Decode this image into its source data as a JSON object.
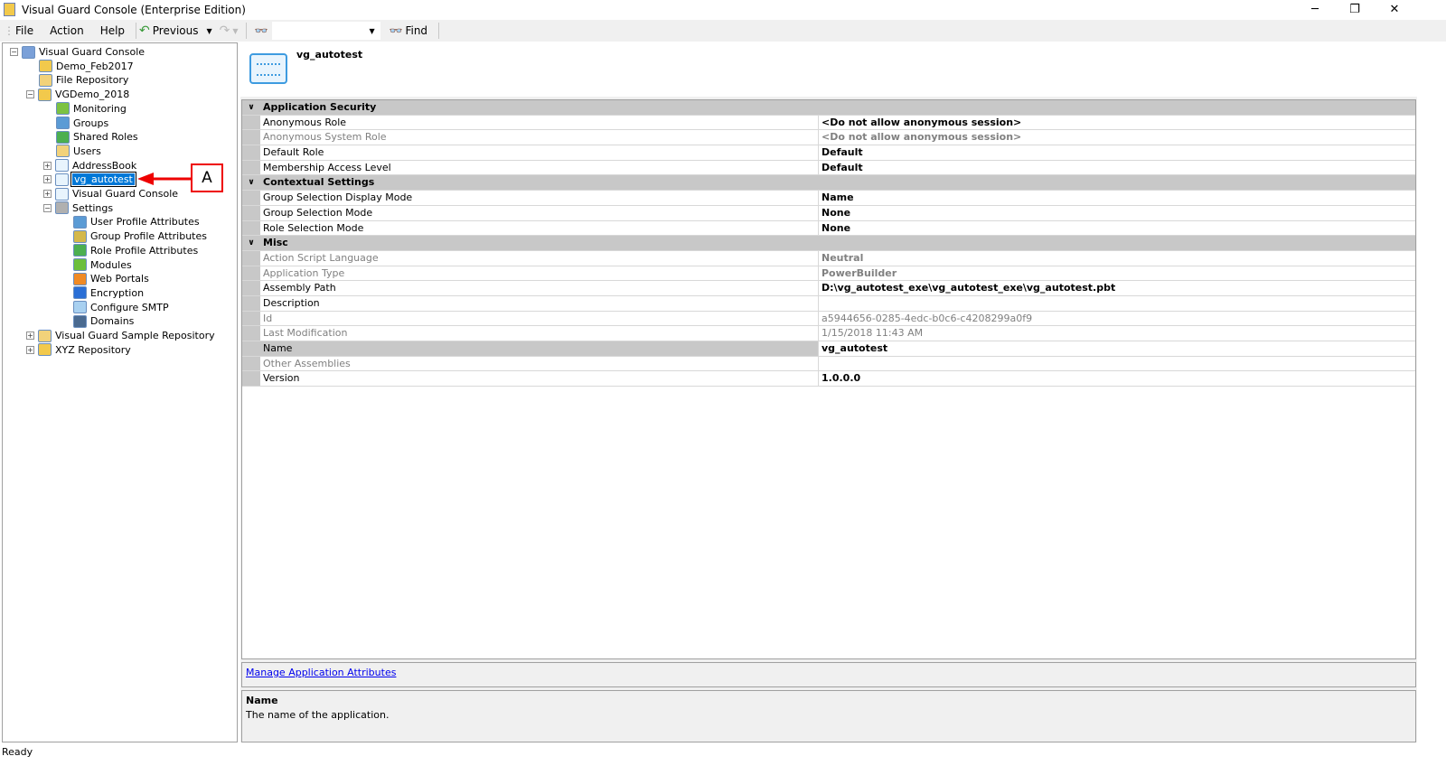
{
  "window": {
    "title": "Visual Guard Console (Enterprise Edition)",
    "minimize": "─",
    "restore": "❐",
    "close": "✕"
  },
  "menu": {
    "file": "File",
    "action": "Action",
    "help": "Help",
    "previous": "Previous",
    "find": "Find",
    "find_value": ""
  },
  "tree": [
    {
      "label": "Visual Guard Console",
      "level": 0,
      "exp": "-",
      "color": "#7aa0d8"
    },
    {
      "label": "Demo_Feb2017",
      "level": 1,
      "exp": "",
      "color": "#f2c94c"
    },
    {
      "label": "File Repository",
      "level": 1,
      "exp": "",
      "color": "#f2d27a"
    },
    {
      "label": "VGDemo_2018",
      "level": 1,
      "exp": "-",
      "color": "#f2c94c"
    },
    {
      "label": "Monitoring",
      "level": 2,
      "exp": "",
      "color": "#7cc242"
    },
    {
      "label": "Groups",
      "level": 2,
      "exp": "",
      "color": "#5b9bd5"
    },
    {
      "label": "Shared Roles",
      "level": 2,
      "exp": "",
      "color": "#4caf50"
    },
    {
      "label": "Users",
      "level": 2,
      "exp": "",
      "color": "#f2d27a"
    },
    {
      "label": "AddressBook",
      "level": 2,
      "exp": "+",
      "color": "#e8f4fd"
    },
    {
      "label": "vg_autotest",
      "level": 2,
      "exp": "+",
      "color": "#e8f4fd",
      "selected": true
    },
    {
      "label": "Visual Guard Console",
      "level": 2,
      "exp": "+",
      "color": "#e8f4fd"
    },
    {
      "label": "Settings",
      "level": 2,
      "exp": "-",
      "color": "#b0b0b0"
    },
    {
      "label": "User Profile Attributes",
      "level": 3,
      "exp": "",
      "color": "#5b9bd5"
    },
    {
      "label": "Group Profile Attributes",
      "level": 3,
      "exp": "",
      "color": "#d4b84a"
    },
    {
      "label": "Role Profile Attributes",
      "level": 3,
      "exp": "",
      "color": "#4caf50"
    },
    {
      "label": "Modules",
      "level": 3,
      "exp": "",
      "color": "#6cbf3c"
    },
    {
      "label": "Web Portals",
      "level": 3,
      "exp": "",
      "color": "#f08a24"
    },
    {
      "label": "Encryption",
      "level": 3,
      "exp": "",
      "color": "#2a6fd6"
    },
    {
      "label": "Configure SMTP",
      "level": 3,
      "exp": "",
      "color": "#a8d0f0"
    },
    {
      "label": "Domains",
      "level": 3,
      "exp": "",
      "color": "#4a6a90"
    },
    {
      "label": "Visual Guard Sample Repository",
      "level": 1,
      "exp": "+",
      "color": "#f2d27a"
    },
    {
      "label": "XYZ Repository",
      "level": 1,
      "exp": "+",
      "color": "#f2c94c"
    }
  ],
  "callout": "A",
  "detail": {
    "title": "vg_autotest"
  },
  "grid": [
    {
      "category": "Application Security"
    },
    {
      "key": "Anonymous Role",
      "value": "<Do not allow anonymous session>"
    },
    {
      "key": "Anonymous System Role",
      "value": "<Do not allow anonymous session>",
      "dim": true
    },
    {
      "key": "Default Role",
      "value": "Default"
    },
    {
      "key": "Membership Access Level",
      "value": "Default"
    },
    {
      "category": "Contextual Settings"
    },
    {
      "key": "Group Selection Display Mode",
      "value": "Name"
    },
    {
      "key": "Group Selection Mode",
      "value": "None"
    },
    {
      "key": "Role Selection Mode",
      "value": "None"
    },
    {
      "category": "Misc"
    },
    {
      "key": "Action Script Language",
      "value": "Neutral",
      "dim": true
    },
    {
      "key": "Application Type",
      "value": "PowerBuilder",
      "dim": true
    },
    {
      "key": "Assembly Path",
      "value": "D:\\vg_autotest_exe\\vg_autotest_exe\\vg_autotest.pbt"
    },
    {
      "key": "Description",
      "value": ""
    },
    {
      "key": "Id",
      "value": "a5944656-0285-4edc-b0c6-c4208299a0f9",
      "dim": true,
      "plain": true
    },
    {
      "key": "Last Modification",
      "value": "1/15/2018 11:43 AM",
      "dim": true,
      "plain": true
    },
    {
      "key": "Name",
      "value": "vg_autotest",
      "selected": true
    },
    {
      "key": "Other Assemblies",
      "value": "",
      "dim": true
    },
    {
      "key": "Version",
      "value": "1.0.0.0"
    }
  ],
  "link": "Manage Application Attributes",
  "description": {
    "title": "Name",
    "text": "The name of the application."
  },
  "status": "Ready"
}
